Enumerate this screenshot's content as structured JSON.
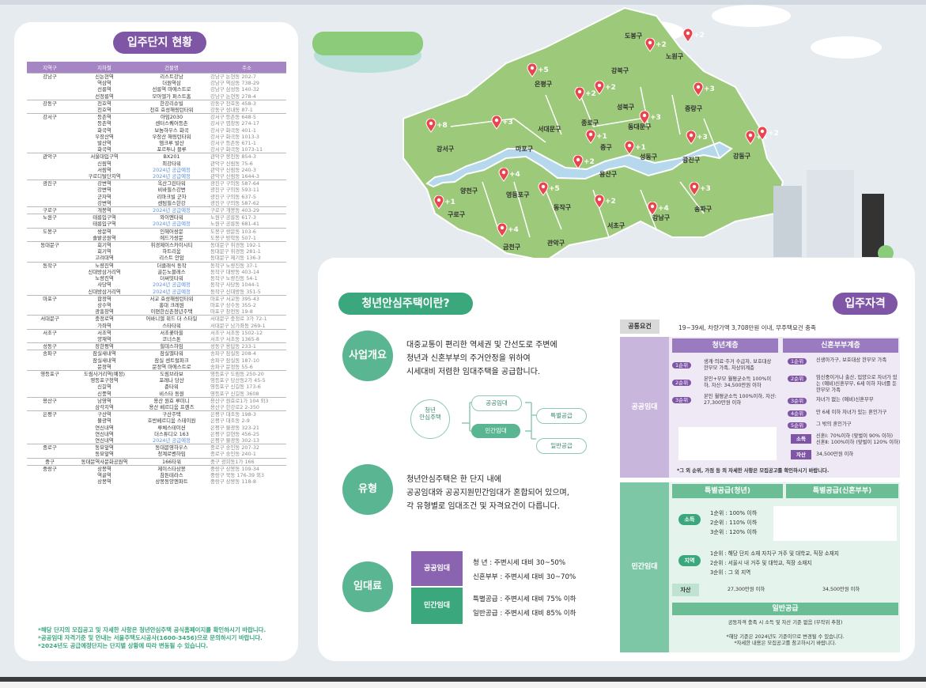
{
  "left": {
    "title": "입주단지 현황",
    "headers": [
      "지역구",
      "지하철",
      "건물명",
      "주소"
    ],
    "rows": [
      {
        "gu": "강남구",
        "st": "신논현역",
        "nm": "리스트강남",
        "ad": "강남구 논현동 202-7",
        "sep": true
      },
      {
        "gu": "",
        "st": "역삼역",
        "nm": "더원역삼",
        "ad": "강남구 역삼동 738-29"
      },
      {
        "gu": "",
        "st": "선릉역",
        "nm": "선릉역 마에스트로",
        "ad": "강남구 삼성동 140-32"
      },
      {
        "gu": "",
        "st": "선정릉역",
        "nm": "모아엘가 퍼스트홈",
        "ad": "강남구 논현동 278-4"
      },
      {
        "gu": "강동구",
        "st": "천호역",
        "nm": "한강리슈빌",
        "ad": "강동구 천호동 458-3",
        "sep": true
      },
      {
        "gu": "",
        "st": "천호역",
        "nm": "천호 효성해링턴타워",
        "ad": "강동구 성내동 87-1"
      },
      {
        "gu": "강서구",
        "st": "등촌역",
        "nm": "아임2030",
        "ad": "강서구 등촌동 648-5",
        "sep": true
      },
      {
        "gu": "",
        "st": "등촌역",
        "nm": "센터스퀘어등촌",
        "ad": "강서구 염창동 274-17"
      },
      {
        "gu": "",
        "st": "화곡역",
        "nm": "보눔하우스 화곡",
        "ad": "강서구 화곡동 401-1"
      },
      {
        "gu": "",
        "st": "우장산역",
        "nm": "우장산 해링턴타워",
        "ad": "강서구 화곡동 1013-3"
      },
      {
        "gu": "",
        "st": "발산역",
        "nm": "엠크루 발산",
        "ad": "강서구 등촌동 671-1"
      },
      {
        "gu": "",
        "st": "화곡역",
        "nm": "포르투나 블루",
        "ad": "강서구 화곡동 1073-11"
      },
      {
        "gu": "관악구",
        "st": "서울대입구역",
        "nm": "BX201",
        "ad": "관악구 봉천동 854-3",
        "sep": true
      },
      {
        "gu": "",
        "st": "신림역",
        "nm": "최강타워",
        "ad": "관악구 신림동 75-6"
      },
      {
        "gu": "",
        "st": "서림역",
        "nm": "2024년 공급예정",
        "ad": "관악구 신림동 240-3",
        "plan": true
      },
      {
        "gu": "",
        "st": "구로디털단지역",
        "nm": "2024년 공급예정",
        "ad": "관악구 신림동 1644-3",
        "plan": true
      },
      {
        "gu": "광진구",
        "st": "강변역",
        "nm": "옥산그린타워",
        "ad": "광진구 구의동 587-64",
        "sep": true
      },
      {
        "gu": "",
        "st": "강변역",
        "nm": "비바힐스강변",
        "ad": "광진구 구의동 593-11"
      },
      {
        "gu": "",
        "st": "군자역",
        "nm": "리마크빌 군자",
        "ad": "광진구 구의동 637-5"
      },
      {
        "gu": "",
        "st": "강변역",
        "nm": "센텀힐스한강",
        "ad": "광진구 구의동 587-62"
      },
      {
        "gu": "구로구",
        "st": "개봉역",
        "nm": "2024년 공급예정",
        "ad": "구로구 개봉동 403-29",
        "plan": true,
        "sep": true
      },
      {
        "gu": "노원구",
        "st": "태릉입구역",
        "nm": "와이엔타워",
        "ad": "노원구 공릉동 617-3",
        "sep": true
      },
      {
        "gu": "",
        "st": "태릉입구역",
        "nm": "2024년 공급예정",
        "ad": "노원구 공릉동 681-41",
        "plan": true
      },
      {
        "gu": "도봉구",
        "st": "쌍문역",
        "nm": "인헤어쌍문",
        "ad": "도봉구 쌍문동 103-6",
        "sep": true
      },
      {
        "gu": "",
        "st": "솔밭공원역",
        "nm": "에드가쌍문",
        "ad": "도봉구 방학동 507-1"
      },
      {
        "gu": "동대문구",
        "st": "회기역",
        "nm": "휘경제이스카이시티",
        "ad": "동대문구 휘경동 192-1",
        "sep": true
      },
      {
        "gu": "",
        "st": "회기역",
        "nm": "하트리움",
        "ad": "동대문구 휘경동 281-1"
      },
      {
        "gu": "",
        "st": "고려대역",
        "nm": "리스트 안암",
        "ad": "동대문구 제기동 136-3"
      },
      {
        "gu": "동작구",
        "st": "노량진역",
        "nm": "더클래식 동작",
        "ad": "동작구 노량진동 37-1",
        "sep": true
      },
      {
        "gu": "",
        "st": "신대방삼거리역",
        "nm": "골든노블레스",
        "ad": "동작구 대방동 403-14"
      },
      {
        "gu": "",
        "st": "노량진역",
        "nm": "더써밋타워",
        "ad": "동작구 노량진동 54-1"
      },
      {
        "gu": "",
        "st": "사당역",
        "nm": "2024년 공급예정",
        "ad": "동작구 사당동 1044-1",
        "plan": true
      },
      {
        "gu": "",
        "st": "신대방삼거리역",
        "nm": "2024년 공급예정",
        "ad": "동작구 신대방동 351-5",
        "plan": true
      },
      {
        "gu": "마포구",
        "st": "합정역",
        "nm": "서교 효성해링턴타워",
        "ad": "마포구 서교동 395-43",
        "sep": true
      },
      {
        "gu": "",
        "st": "상수역",
        "nm": "홍대 크레원",
        "ad": "마포구 상수동 355-2"
      },
      {
        "gu": "",
        "st": "광흥창역",
        "nm": "이편한신촌청년주택",
        "ad": "마포구 창전동 19-8"
      },
      {
        "gu": "서대문구",
        "st": "충정로역",
        "nm": "어바니엘 위드 더 스타일",
        "ad": "서대문구 충정로 3가 72-1",
        "sep": true
      },
      {
        "gu": "",
        "st": "가좌역",
        "nm": "스타타워",
        "ad": "서대문구 남가좌동 269-1"
      },
      {
        "gu": "서초구",
        "st": "서초역",
        "nm": "서초꽃마을",
        "ad": "서초구 서초동 1502-12",
        "sep": true
      },
      {
        "gu": "",
        "st": "양재역",
        "nm": "코너스톤",
        "ad": "서초구 서초동 1365-8"
      },
      {
        "gu": "성동구",
        "st": "장한평역",
        "nm": "힐데스하임",
        "ad": "성동구 용답동 233-1",
        "sep": true
      },
      {
        "gu": "송파구",
        "st": "잠실새내역",
        "nm": "잠실엘타워",
        "ad": "송파구 잠실동 208-4",
        "sep": true
      },
      {
        "gu": "",
        "st": "잠실새내역",
        "nm": "잠실 센트럴파크",
        "ad": "송파구 잠실동 187-10"
      },
      {
        "gu": "",
        "st": "문정역",
        "nm": "문정역 마에스트로",
        "ad": "송파구 문정동 55-6"
      },
      {
        "gu": "영등포구",
        "st": "도림사거리역(예정)",
        "nm": "도림브라보",
        "ad": "영등포구 도림동 250-20",
        "sep": true
      },
      {
        "gu": "",
        "st": "영등포구청역",
        "nm": "포레나 당산",
        "ad": "영등포구 당산동2가 45-5"
      },
      {
        "gu": "",
        "st": "신길역",
        "nm": "준타워",
        "ad": "영등포구 신길동 173-6"
      },
      {
        "gu": "",
        "st": "신풍역",
        "nm": "비스타 동원",
        "ad": "영등포구 신길동 3608"
      },
      {
        "gu": "용산구",
        "st": "남영역",
        "nm": "용산 원효 루미니",
        "ad": "용산구 원효로1가 104 외3",
        "sep": true
      },
      {
        "gu": "",
        "st": "삼각지역",
        "nm": "용산 베르디움 프렌즈",
        "ad": "용산구 한강로2 2-350"
      },
      {
        "gu": "은평구",
        "st": "구산역",
        "nm": "구산주택",
        "ad": "은평구 대조동 198-3",
        "sep": true
      },
      {
        "gu": "",
        "st": "불광역",
        "nm": "호반베르디움 스테이원",
        "ad": "은평구 대조동 2-9"
      },
      {
        "gu": "",
        "st": "연신내역",
        "nm": "루체스테이션",
        "ad": "은평구 불광동 323-21"
      },
      {
        "gu": "",
        "st": "연신내역",
        "nm": "더스튜디오 163",
        "ad": "은평구 갈현동 456-25"
      },
      {
        "gu": "",
        "st": "연신내역",
        "nm": "2024년 공급예정",
        "ad": "은평구 불광동 302-13",
        "plan": true
      },
      {
        "gu": "종로구",
        "st": "동묘앞역",
        "nm": "동대문영하우스",
        "ad": "종로구 숭인동 207-32",
        "sep": true
      },
      {
        "gu": "",
        "st": "동묘앞역",
        "nm": "청계로벤하임",
        "ad": "종로구 숭인동 240-1"
      },
      {
        "gu": "중구",
        "st": "동대문역사문화공원역",
        "nm": "166타워",
        "ad": "중구 광희동1가 166",
        "sep": true
      },
      {
        "gu": "중랑구",
        "st": "상봉역",
        "nm": "제이스타상봉",
        "ad": "중랑구 상봉동 109-34",
        "sep": true
      },
      {
        "gu": "",
        "st": "역골역",
        "nm": "참튼테라스",
        "ad": "중랑구 묵동 176-39 외3"
      },
      {
        "gu": "",
        "st": "상봉역",
        "nm": "상봉동양엔파트",
        "ad": "중랑구 상봉동 118-8"
      }
    ],
    "notes": [
      "*해당 단지의 모집공고 및 자세한 사항은 청년안심주택 공식홈페이지를 확인하시기 바랍니다.",
      "*공공임대 자격기준 및 안내는 서울주택도시공사(1600-3456)으로 문의하시기 바랍니다.",
      "*2024년도 공급예정단지는 단지별 상황에 따라 변동될 수 있습니다."
    ]
  },
  "map": {
    "districts": [
      "도봉구",
      "노원구",
      "강북구",
      "은평구",
      "성북구",
      "중랑구",
      "종로구",
      "동대문구",
      "서대문구",
      "강서구",
      "마포구",
      "중구",
      "성동구",
      "광진구",
      "강동구",
      "용산구",
      "양천구",
      "영등포구",
      "동작구",
      "구로구",
      "서초구",
      "강남구",
      "송파구",
      "금천구",
      "관악구"
    ],
    "markers": [
      "+2",
      "+2",
      "+5",
      "+2",
      "+2",
      "+3",
      "+3",
      "+8",
      "+3",
      "+1",
      "+1",
      "+3",
      "+4",
      "+2",
      "+2",
      "+4",
      "+5",
      "+1",
      "+2",
      "+4",
      "+3",
      "+4"
    ]
  },
  "info": {
    "what_title": "청년안심주택이란?",
    "qual_title": "입주자격",
    "overview_label": "사업개요",
    "overview_text": [
      "대중교통이 편리한 역세권 및 간선도로 주변에",
      "청년과 신혼부부의 주거안정을 위하여",
      "시세대비 저렴한 임대주택을 공급합니다."
    ],
    "flow": {
      "center": "청년\n안심주택",
      "public": "공공임대",
      "private": "민간임대",
      "special": "특별공급",
      "general": "일반공급"
    },
    "type_label": "유형",
    "type_text": [
      "청년안심주택은 한 단지 내에",
      "공공임대와 공공지원민간임대가 혼합되어 있으며,",
      "각 유형별로 임대조건 및 자격요건이 다릅니다."
    ],
    "rent_label": "임대료",
    "rent": {
      "public_label": "공공임대",
      "public_lines": [
        "청       년 : 주변시세 대비 30~50%",
        "신혼부부 : 주변시세 대비 30~70%"
      ],
      "private_label": "민간임대",
      "private_lines": [
        "특별공급 : 주변시세 대비 75% 이하",
        "일반공급 : 주변시세 대비 85% 이하"
      ]
    }
  },
  "qual": {
    "common_label": "공통요건",
    "common_text": "19~39세, 차량가액 3,708만원 이내, 무주택요건 충족",
    "public_label": "공공임대",
    "youth_head": "청년계층",
    "newly_head": "신혼부부계층",
    "youth_ranks": [
      {
        "rank": "1순위",
        "text": "생계·의료·주거 수급자, 보호대상 한부모 가족, 차상위계층"
      },
      {
        "rank": "2순위",
        "text": "본인+부모 월평균소득 100%이하, 자산: 34,500만원 이하"
      },
      {
        "rank": "3순위",
        "text": "본인 월평균소득 100%이하, 자산: 27,300만원 이하"
      }
    ],
    "newly_ranks": [
      {
        "rank": "1순위",
        "text": "신생아가구, 보호대상 한부모 가족"
      },
      {
        "rank": "2순위",
        "text": "임신중이거나 출산, 입양으로 자녀가 있는 (예비)신혼부부, 6세 이하 자녀를 둔 한부모 가족"
      },
      {
        "rank": "3순위",
        "text": "자녀가 없는 (예비)신혼부부"
      },
      {
        "rank": "4순위",
        "text": "만 6세 이하 자녀가 있는 혼인가구"
      },
      {
        "rank": "5순위",
        "text": "그 밖의 혼인가구"
      }
    ],
    "newly_income_label": "소득",
    "newly_income": [
      "신혼Ⅰ: 70%이하 (맞벌이 90% 이하)",
      "신혼Ⅱ: 100%이하 (맞벌이 120% 이하)"
    ],
    "newly_asset_label": "자산",
    "newly_asset": "34,500만원 이하",
    "public_note": "*그 외 순위, 가점 등 의 자세한 사항은 모집공고를 확인하시기 바랍니다.",
    "private_label": "민간임대",
    "special_youth": "특별공급(청년)",
    "special_newly": "특별공급(신혼부부)",
    "income_label": "소득",
    "income_ranks": [
      "1순위 : 100% 이하",
      "2순위 : 110% 이하",
      "3순위 : 120% 이하"
    ],
    "region_label": "지역",
    "region_ranks": [
      "1순위 : 해당 단지 소재 자치구 거주 및 대학교, 직장 소재지",
      "2순위 : 서울시 내 거주 및 대학교, 직장 소재지",
      "3순위 : 그 외 지역"
    ],
    "asset_label": "자산",
    "asset_youth": "27,300만원 이하",
    "asset_newly": "34,500만원 이하",
    "general_head": "일반공급",
    "general_text": "공동자격 충족 시 소득 및 자산 기준 없음 (무작위 추첨)",
    "footer_notes": [
      "*해당 기준은 2024년도 기준이므로 변경될 수 있습니다.",
      "*자세한 내용은 모집공고를 참고하시기 바랍니다."
    ]
  }
}
